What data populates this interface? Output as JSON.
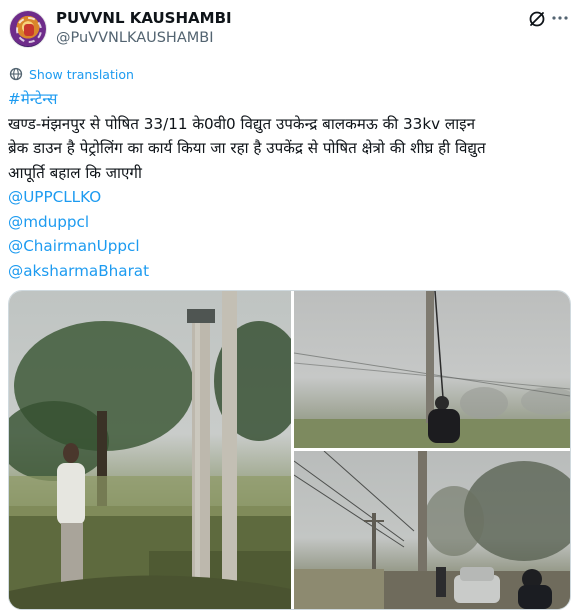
{
  "author": {
    "display_name": "PUVVNL KAUSHAMBI",
    "handle": "@PuVVNLKAUSHAMBI"
  },
  "header": {
    "grok_icon": "grok-slash-circle-icon",
    "more_icon": "more-dots-icon"
  },
  "translation": {
    "label": "Show translation",
    "icon": "globe-translate-icon"
  },
  "tweet": {
    "hashtag": "#मेन्टेन्स",
    "lines": [
      "खण्ड-मंझनपुर से पोषित 33/11 के0वी0 विद्युत उपकेन्द्र बालकमऊ की 33kv लाइन",
      "ब्रेक डाउन है पेट्रोलिंग का कार्य किया जा रहा है उपकेंद्र से पोषित क्षेत्रो की शीघ्र ही विद्युत",
      "आपूर्ति बहाल कि जाएगी"
    ],
    "mentions": [
      "@UPPCLLKO",
      "@mduppcl",
      "@ChairmanUppcl",
      "@aksharmaBharat"
    ]
  },
  "colors": {
    "link": "#1d9bf0",
    "text": "#0f1419",
    "secondary": "#536471",
    "border": "#cfd9de"
  }
}
